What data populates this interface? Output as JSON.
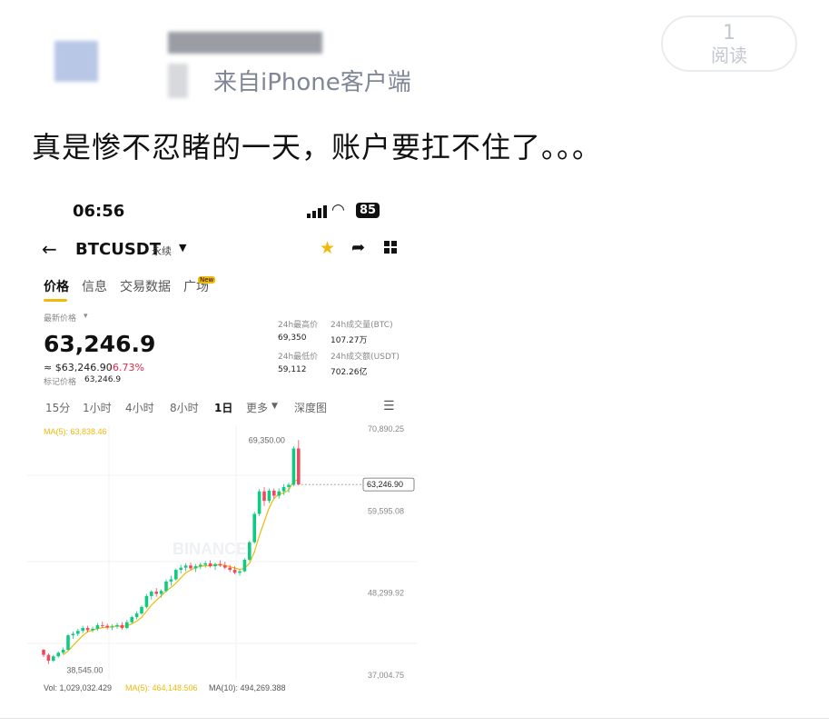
{
  "post": {
    "source": "来自iPhone客户端",
    "read_count": "1",
    "read_label": "阅读",
    "text": "真是惨不忍睹的一天，账户要扛不住了。。。"
  },
  "screenshot": {
    "status_bar": {
      "time": "06:56",
      "battery": "85"
    },
    "header": {
      "symbol": "BTCUSDT",
      "contract_type": "永续"
    },
    "tabs": [
      {
        "label": "价格",
        "active": true
      },
      {
        "label": "信息"
      },
      {
        "label": "交易数据"
      },
      {
        "label": "广场",
        "badge": "New"
      }
    ],
    "price": {
      "label": "最新价格",
      "last": "63,246.9",
      "fiat": "≈ $63,246.90",
      "change": "-6.73%",
      "mark_label": "标记价格",
      "mark_value": "63,246.9"
    },
    "stats": {
      "high_label": "24h最高价",
      "high": "69,350",
      "low_label": "24h最低价",
      "low": "59,112",
      "vol_btc_label": "24h成交量(BTC)",
      "vol_btc": "107.27万",
      "vol_usdt_label": "24h成交额(USDT)",
      "vol_usdt": "702.26亿"
    },
    "intervals": [
      "15分",
      "1小时",
      "4小时",
      "8小时",
      "1日",
      "更多",
      "深度图"
    ],
    "active_interval": "1日",
    "colors": {
      "up": "#0ecb81",
      "down": "#f6465d",
      "accent": "#f0b90b",
      "ma5": "#f0b90b",
      "ma10": "#b882ff"
    }
  },
  "chart_data": {
    "type": "candlestick",
    "ma5_label": "MA(5): 63,838.46",
    "y_axis_labels": [
      "70,890.25",
      "59,595.08",
      "48,299.92",
      "37,004.75"
    ],
    "ylim": [
      37004.75,
      70890.25
    ],
    "high_marker": "69,350.00",
    "low_marker": "38,545.00",
    "current_price_tag": "63,246.90",
    "watermark": "BINANCE",
    "volume_row": {
      "vol": "Vol: 1,029,032.429",
      "ma5": "MA(5): 464,148.506",
      "ma10": "MA(10): 494,269.388"
    },
    "candles": [
      [
        40500,
        40600,
        39500,
        39800
      ],
      [
        39800,
        40000,
        38545,
        39000
      ],
      [
        39000,
        39800,
        38800,
        39600
      ],
      [
        39600,
        40300,
        39400,
        40100
      ],
      [
        40100,
        40800,
        39900,
        40500
      ],
      [
        40500,
        42700,
        40400,
        42500
      ],
      [
        42500,
        43000,
        42000,
        42700
      ],
      [
        42700,
        43400,
        42400,
        43100
      ],
      [
        43100,
        43800,
        42800,
        43500
      ],
      [
        43500,
        43800,
        42900,
        43200
      ],
      [
        43200,
        43700,
        42900,
        43400
      ],
      [
        43400,
        44200,
        43100,
        43900
      ],
      [
        43900,
        44400,
        43500,
        43800
      ],
      [
        43800,
        44100,
        43300,
        43600
      ],
      [
        43600,
        44000,
        43200,
        43700
      ],
      [
        43700,
        44200,
        43400,
        43900
      ],
      [
        43900,
        44300,
        43300,
        43500
      ],
      [
        43500,
        44600,
        43400,
        44300
      ],
      [
        44300,
        45200,
        44100,
        45000
      ],
      [
        45000,
        45800,
        44700,
        45500
      ],
      [
        45500,
        46600,
        45300,
        46400
      ],
      [
        46400,
        48200,
        46200,
        47900
      ],
      [
        47900,
        48700,
        47400,
        48500
      ],
      [
        48500,
        49000,
        47800,
        48200
      ],
      [
        48200,
        48800,
        47700,
        48600
      ],
      [
        48600,
        50200,
        48400,
        49900
      ],
      [
        49900,
        50700,
        49300,
        50200
      ],
      [
        50200,
        51700,
        50000,
        51500
      ],
      [
        51500,
        52200,
        51000,
        51800
      ],
      [
        51800,
        52400,
        51300,
        52100
      ],
      [
        52100,
        52500,
        51500,
        51700
      ],
      [
        51700,
        52300,
        51200,
        52000
      ],
      [
        52000,
        52500,
        51600,
        52200
      ],
      [
        52200,
        52700,
        51800,
        52400
      ],
      [
        52400,
        52800,
        51800,
        52000
      ],
      [
        52000,
        52500,
        51500,
        52300
      ],
      [
        52300,
        52800,
        51900,
        52100
      ],
      [
        52100,
        52600,
        51600,
        51800
      ],
      [
        51800,
        52200,
        51200,
        51500
      ],
      [
        51500,
        52000,
        50900,
        51100
      ],
      [
        51100,
        51600,
        50700,
        51300
      ],
      [
        51300,
        53100,
        51200,
        52900
      ],
      [
        52900,
        55500,
        52700,
        55300
      ],
      [
        55300,
        59500,
        55100,
        59200
      ],
      [
        59200,
        62600,
        58900,
        62300
      ],
      [
        62300,
        62900,
        60300,
        61000
      ],
      [
        61000,
        62700,
        60700,
        62400
      ],
      [
        62400,
        62700,
        61300,
        61700
      ],
      [
        61700,
        62700,
        61300,
        62300
      ],
      [
        62300,
        63300,
        61800,
        62900
      ],
      [
        62900,
        63500,
        62100,
        63200
      ],
      [
        63200,
        68500,
        63000,
        68200
      ],
      [
        68200,
        69350,
        63100,
        63246.9
      ]
    ]
  }
}
